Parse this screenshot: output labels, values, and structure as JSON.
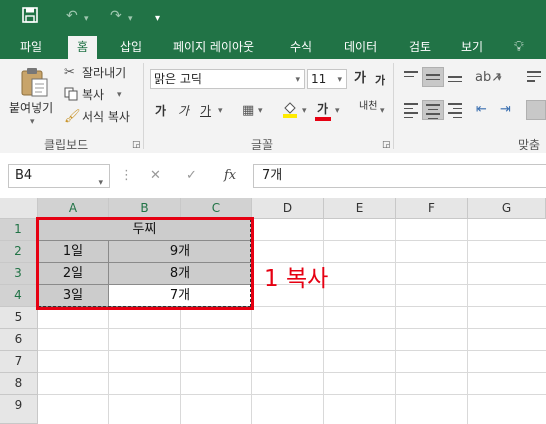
{
  "quick_access": {
    "save_icon": "save-icon",
    "undo_icon": "undo-icon",
    "redo_icon": "redo-icon",
    "customize_icon": "customize-qat-icon"
  },
  "tabs": [
    {
      "label": "파일"
    },
    {
      "label": "홈"
    },
    {
      "label": "삽입"
    },
    {
      "label": "페이지 레이아웃"
    },
    {
      "label": "수식"
    },
    {
      "label": "데이터"
    },
    {
      "label": "검토"
    },
    {
      "label": "보기"
    }
  ],
  "active_tab": "홈",
  "tell_me_icon": "lightbulb-icon",
  "ribbon": {
    "clipboard": {
      "paste_label": "붙여넣기",
      "cut_label": "잘라내기",
      "copy_label": "복사",
      "format_painter_label": "서식 복사",
      "group_label": "클립보드"
    },
    "font": {
      "font_name": "맑은 고딕",
      "font_size": "11",
      "grow_label": "가",
      "shrink_label": "가",
      "bold_label": "가",
      "italic_label": "가",
      "underline_label": "가",
      "font_color_label": "가",
      "phonetic_label": "내천",
      "group_label": "글꼴"
    },
    "alignment": {
      "group_label": "맞춤"
    }
  },
  "formula_bar": {
    "name_box": "B4",
    "fx_label": "fx",
    "content": "7개"
  },
  "columns": [
    "A",
    "B",
    "C",
    "D",
    "E",
    "F",
    "G"
  ],
  "rows": [
    "1",
    "2",
    "3",
    "4",
    "5",
    "6",
    "7",
    "8",
    "9"
  ],
  "sheet": {
    "title": "두찌",
    "rows": [
      {
        "day": "1일",
        "qty": "9개"
      },
      {
        "day": "2일",
        "qty": "8개"
      },
      {
        "day": "3일",
        "qty": "7개"
      }
    ]
  },
  "annotation": "1 복사",
  "colors": {
    "excel_green": "#217346",
    "annotation_red": "#e60012",
    "selection_grey": "#cccccc"
  }
}
